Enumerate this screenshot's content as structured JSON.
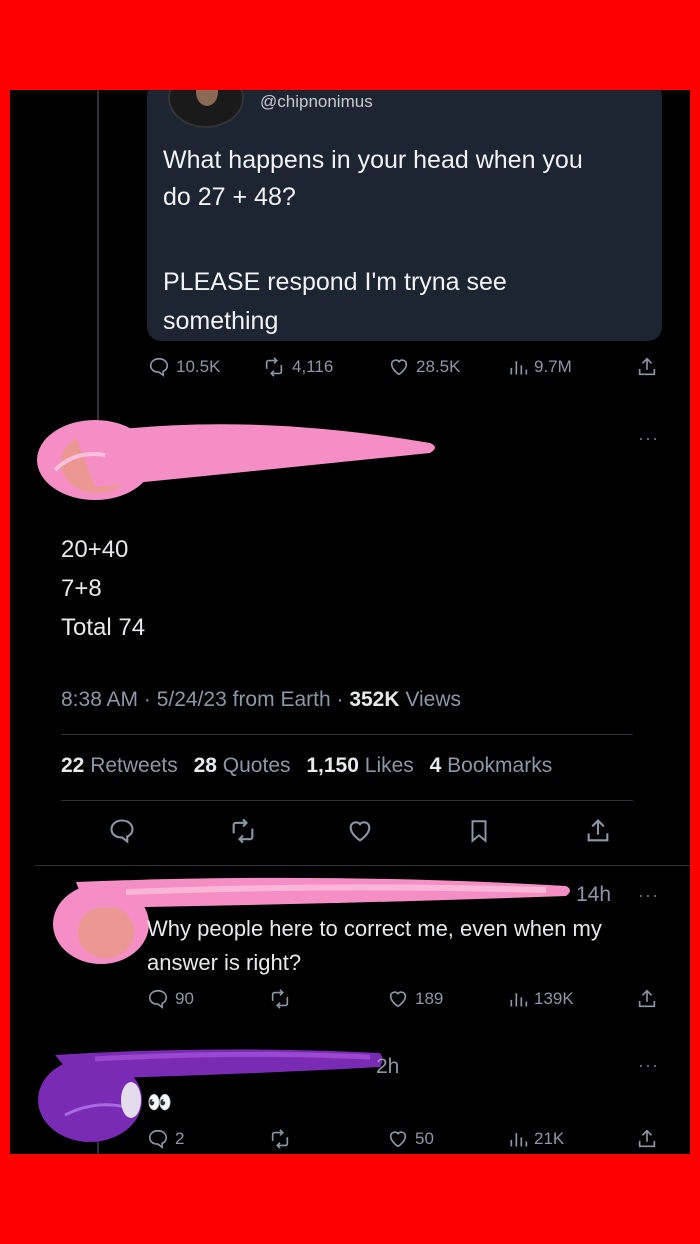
{
  "quoted_tweet": {
    "handle": "@chipnonimus",
    "text_line1": "What happens in your head when you",
    "text_line2": "do 27 + 48?",
    "text_line3": "PLEASE respond I'm tryna see",
    "text_line4": "something",
    "replies": "10.5K",
    "retweets": "4,116",
    "likes": "28.5K",
    "views": "9.7M"
  },
  "main_tweet": {
    "line1": "20+40",
    "line2": "7+8",
    "line3": "Total 74",
    "meta_time": "8:38 AM · 5/24/23 from Earth · ",
    "meta_views_count": "352K",
    "meta_views_label": " Views",
    "retweets_count": "22",
    "retweets_label": "Retweets",
    "quotes_count": "28",
    "quotes_label": "Quotes",
    "likes_count": "1,150",
    "likes_label": "Likes",
    "bookmarks_count": "4",
    "bookmarks_label": "Bookmarks",
    "more": "···"
  },
  "reply1": {
    "time": "14h",
    "more": "···",
    "text_line1": "Why people here to correct me, even when my",
    "text_line2": "answer is right?",
    "replies": "90",
    "likes": "189",
    "views": "139K"
  },
  "reply2": {
    "time": "2h",
    "more": "···",
    "text": "👀",
    "replies": "2",
    "likes": "50",
    "views": "21K"
  },
  "colors": {
    "frame": "#ff0000",
    "background": "#000000",
    "quote_card": "#1d2533",
    "muted": "#8b98a5",
    "pink_redaction": "#f48ec4",
    "purple_redaction": "#7a2bb5"
  },
  "icons": [
    "reply-icon",
    "retweet-icon",
    "like-icon",
    "views-icon",
    "share-icon",
    "bookmark-icon",
    "more-icon"
  ]
}
